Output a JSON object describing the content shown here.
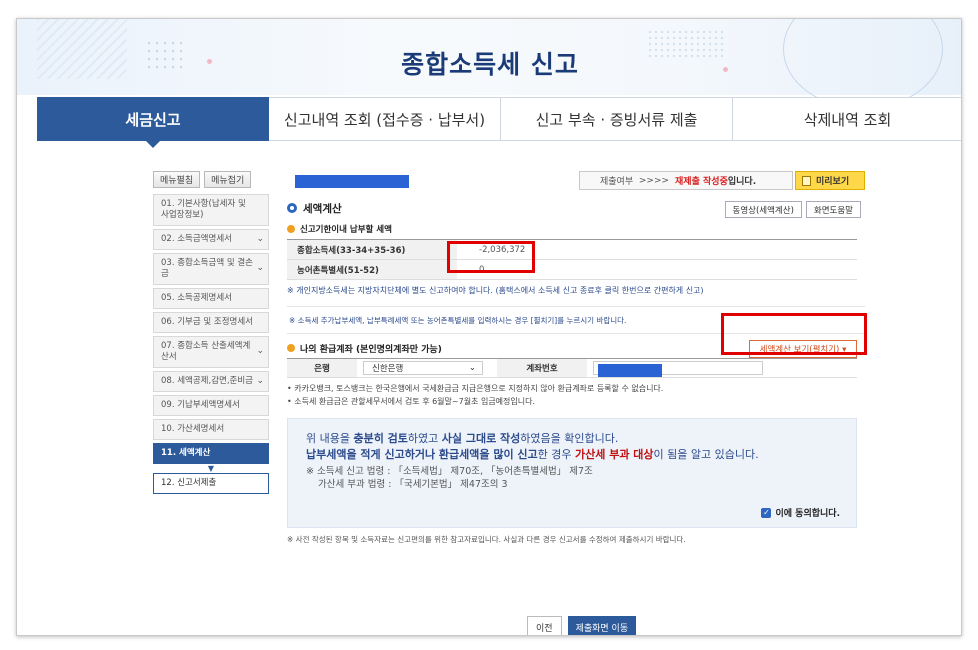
{
  "page_title": "종합소득세 신고",
  "tabs": [
    {
      "label": "세금신고",
      "active": true
    },
    {
      "label": "신고내역 조회 (접수증 · 납부서)"
    },
    {
      "label": "신고 부속 · 증빙서류 제출"
    },
    {
      "label": "삭제내역 조회"
    }
  ],
  "sidebar": {
    "expand_label": "메뉴펼침",
    "collapse_label": "메뉴접기",
    "items": [
      {
        "label": "01. 기본사항(납세자 및 사업장정보)"
      },
      {
        "label": "02. 소득금액명세서"
      },
      {
        "label": "03. 종합소득금액 및 결손금"
      },
      {
        "label": "05. 소득공제명세서"
      },
      {
        "label": "06. 기부금 및 조정명세서"
      },
      {
        "label": "07. 종합소득 산출세액계산서"
      },
      {
        "label": "08. 세액공제,감면,준비금"
      },
      {
        "label": "09. 기납부세액명세서"
      },
      {
        "label": "10. 가산세명세서"
      },
      {
        "label": "11. 세액계산"
      },
      {
        "label": "12. 신고서제출"
      }
    ]
  },
  "status": {
    "label": "제출여부",
    "arrows": ">>>>",
    "warning": "재제출 작성중",
    "suffix": "입니다.",
    "preview_label": "미리보기"
  },
  "tax_calc": {
    "title": "세액계산",
    "video_btn": "동영상(세액계산)",
    "help_btn": "화면도움말",
    "subtitle": "신고기한이내 납부할 세액",
    "rows": [
      {
        "label": "종합소득세(33-34+35-36)",
        "value": "-2,036,372"
      },
      {
        "label": "농어촌특별세(51-52)",
        "value": "0"
      }
    ],
    "note": "※ 개인지방소득세는 지방자치단체에 별도 신고하여야 합니다. (홈택스에서 소득세 신고 종료후 클릭 한번으로 간편하게 신고)",
    "additional_note": "※ 소득세 추가납부세액, 납부특례세액 또는 농어촌특별세를 입력하시는 경우 [펼치기]를 누르시기 바랍니다.",
    "expand_btn": "세액계산 보기(펼치기) ▾"
  },
  "refund": {
    "title": "나의 환급계좌 (본인명의계좌만 가능)",
    "bank_label": "은행",
    "bank_value": "신한은행",
    "account_label": "계좌번호",
    "bullets": [
      "• 카카오뱅크, 토스뱅크는 한국은행에서 국세환급금 지급은행으로 지정하지 않아 환급계좌로 등록할 수 없습니다.",
      "• 소득세 환급금은 관할세무서에서 검토 후 6월말~7월초 입금예정입니다."
    ]
  },
  "agree": {
    "line1_a": "위 내용을 ",
    "line1_b": "충분히 검토",
    "line1_c": "하였고 ",
    "line1_d": "사실 그대로 작성",
    "line1_e": "하였음을 확인합니다.",
    "line2_a": "납부세액을 적게 신고하거나 환급세액을 많이 신고",
    "line2_b": "한 경우 ",
    "line2_c": "가산세 부과 대상",
    "line2_d": "이 됨을 알고 있습니다.",
    "law1": "※ 소득세 신고 법령 : 「소득세법」 제70조, 「농어촌특별세법」 제7조",
    "law2": "가산세 부과 법령 : 「국세기본법」 제47조의 3",
    "checkbox_label": "이에 동의합니다."
  },
  "footer_note": "※ 사전 작성된 항목 및 소득자료는 신고편의를 위한 참고자료입니다. 사실과 다른 경우 신고서를 수정하여 제출하시기 바랍니다.",
  "buttons": {
    "prev": "이전",
    "next": "제출화면 이동"
  }
}
